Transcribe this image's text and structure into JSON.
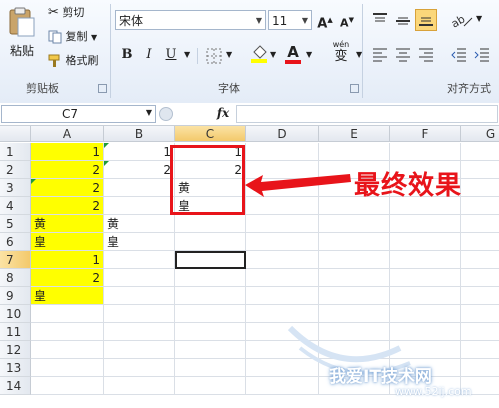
{
  "clipboard": {
    "paste_label": "粘贴",
    "cut_label": "剪切",
    "copy_label": "复制",
    "format_painter_label": "格式刷",
    "group_label": "剪贴板"
  },
  "font": {
    "font_name": "宋体",
    "font_size": "11",
    "group_label": "字体",
    "bold": "B",
    "italic": "I",
    "underline": "U",
    "grow": "A",
    "shrink": "A",
    "font_color_letter": "A",
    "phonetic_label": "wén",
    "phonetic_char": "变"
  },
  "alignment": {
    "group_label": "对齐方式"
  },
  "formula_bar": {
    "name_box": "C7",
    "fx_label": "fx",
    "value": ""
  },
  "columns": [
    "A",
    "B",
    "C",
    "D",
    "E",
    "F",
    "G"
  ],
  "rows": [
    "1",
    "2",
    "3",
    "4",
    "5",
    "6",
    "7",
    "8",
    "9",
    "10",
    "11",
    "12",
    "13",
    "14"
  ],
  "cells": {
    "A1": "1",
    "A2": "2",
    "A3": "2",
    "A4": "2",
    "A5": "黄",
    "A6": "皇",
    "A7": "1",
    "A8": "2",
    "A9": "皇",
    "B1": "1",
    "B2": "2",
    "B5": "黄",
    "B6": "皇",
    "C1": "1",
    "C2": "2",
    "C3": "黄",
    "C4": "皇"
  },
  "annotation": {
    "caption": "最终效果",
    "color": "#e8141a"
  },
  "watermark": {
    "text": "我爱IT技术网",
    "url": "www.52ij.com"
  },
  "colors": {
    "highlight": "#ffff00",
    "font_color_bar": "#e8141a"
  }
}
